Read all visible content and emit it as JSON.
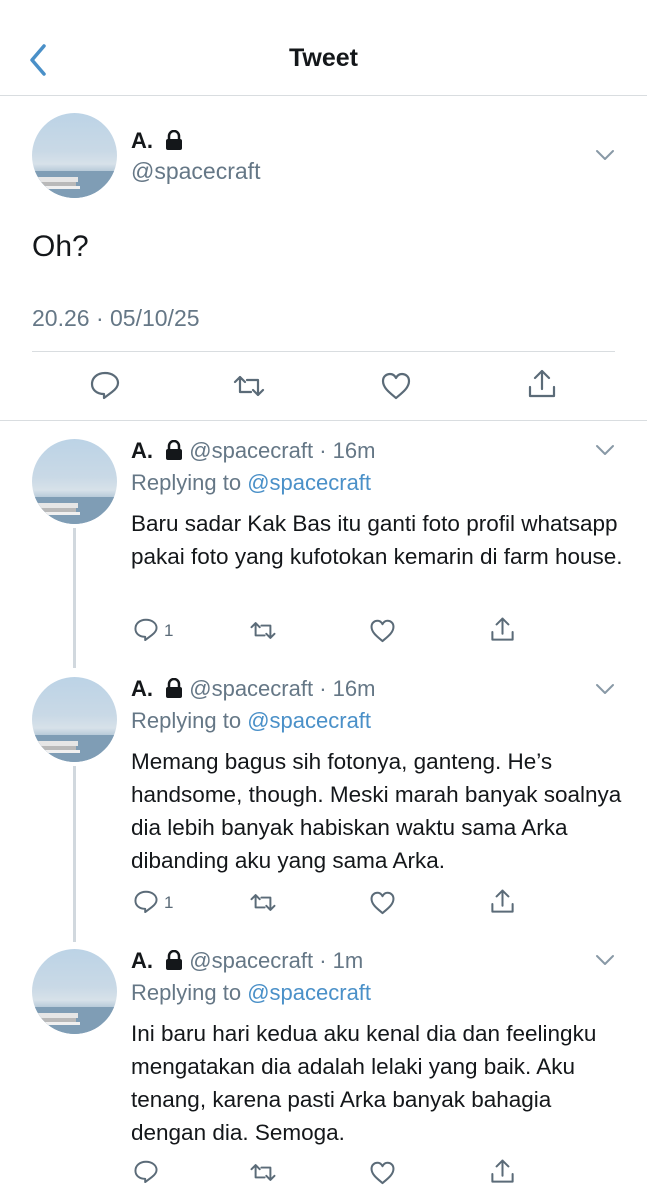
{
  "header": {
    "title": "Tweet"
  },
  "main_tweet": {
    "name": "A.",
    "handle": "@spacecraft",
    "text": "Oh?",
    "timestamp": "20.26 · 05/10/25"
  },
  "replies": [
    {
      "name": "A.",
      "handle_time": "@spacecraft · 16m",
      "replying_label": "Replying to",
      "replying_handle": "@spacecraft",
      "text": "Baru sadar Kak Bas itu ganti foto profil whatsapp pakai foto yang kufotokan kemarin di farm house.",
      "reply_count": "1"
    },
    {
      "name": "A.",
      "handle_time": "@spacecraft · 16m",
      "replying_label": "Replying to",
      "replying_handle": "@spacecraft",
      "text": "Memang bagus sih fotonya, ganteng. He’s handsome, though. Meski marah banyak soalnya dia lebih banyak habiskan waktu sama Arka dibanding aku yang sama Arka.",
      "reply_count": "1"
    },
    {
      "name": "A.",
      "handle_time": "@spacecraft · 1m",
      "replying_label": "Replying to",
      "replying_handle": "@spacecraft",
      "text": "Ini baru hari kedua aku kenal dia dan feelingku mengatakan dia adalah lelaki yang baik. Aku tenang, karena pasti Arka banyak bahagia dengan dia. Semoga.",
      "reply_count": ""
    }
  ],
  "icons": [
    "back-chevron-icon",
    "lock-icon",
    "chevron-down-icon",
    "reply-icon",
    "retweet-icon",
    "like-icon",
    "share-icon"
  ],
  "colors": {
    "accent": "#4a90c8",
    "secondary_text": "#657786",
    "icon": "#5b6b78"
  }
}
